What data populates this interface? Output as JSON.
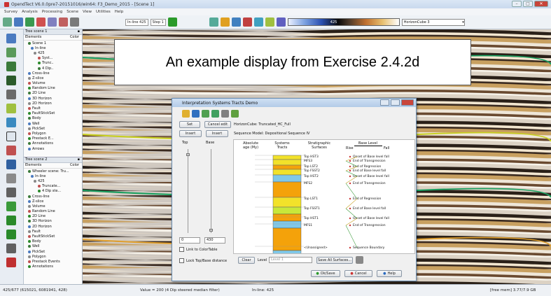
{
  "window": {
    "title": "OpendTect V6.0.0pre7-20151016/win64: F3_Demo_2015 - [Scene 1]"
  },
  "menu": [
    "Survey",
    "Analysis",
    "Processing",
    "Scene",
    "View",
    "Utilities",
    "Help"
  ],
  "toolbar": {
    "inline_label": "In-line 425",
    "step_label": "Step 1",
    "color_value": "425",
    "horizon_select": "HorizonCube 3"
  },
  "banner": {
    "text": "An example display from Exercise 2.4.2d"
  },
  "tree1": {
    "header": "Tree scene 1",
    "col_elements": "Elements",
    "col_color": "Color",
    "items": [
      "Scene 1",
      "In-line",
      "425",
      "Syst...",
      "Trunc..",
      "4 Dip..",
      "Cross-line",
      "Z-slice",
      "Volume",
      "Random Line",
      "2D Line",
      "3D Horizon",
      "2D Horizon",
      "Fault",
      "FaultStickSet",
      "Body",
      "Well",
      "PickSet",
      "Polygon",
      "Prestack E...",
      "Annotations",
      "Arrows"
    ]
  },
  "tree2": {
    "header": "Tree scene 2",
    "col_elements": "Elements",
    "col_color": "Color",
    "items": [
      "Wheeler scene: Tru...",
      "In-line",
      "425",
      "Truncate...",
      "4 Dip ste...",
      "Cross-line",
      "Z-slice",
      "Volume",
      "Random Line",
      "2D Line",
      "3D Horizon",
      "2D Horizon",
      "Fault",
      "FaultStickSet",
      "Body",
      "Well",
      "PickSet",
      "Polygon",
      "Prestack Events",
      "Annotations"
    ]
  },
  "dialog": {
    "title": "Interpretation Systems Tracts Demo",
    "set_btn": "Set",
    "cancel_edit_btn": "Cancel edit",
    "horizoncube": "HorizonCube: Truncated_HC_Full",
    "insert1": "Insert",
    "insert2": "Insert",
    "sequence_model": "Sequence Model: Depositional Sequence IV",
    "top_label": "Top",
    "base_label": "Base",
    "col_age": "Absolute age (My)",
    "col_tracts": "Systems Tracts",
    "col_surfaces": "Stratigraphic Surfaces",
    "col_base": "Base Level",
    "rise": "Rise",
    "fall": "Fall",
    "top_value": "0",
    "base_value": "430",
    "link_colortable": "Link to ColorTable",
    "lock_distance": "Lock Top/Base distance",
    "clear_btn": "Clear",
    "level_label": "Level",
    "level_value": "Level 1",
    "save_surfaces_btn": "Save All Surfaces...",
    "ok_btn": "Ok/Save",
    "cancel_btn": "Cancel",
    "help_btn": "Help",
    "surfaces": [
      "Top HST3",
      "MFS3",
      "Top LST2",
      "Top FSST2",
      "Top HST2",
      "MFS2",
      "Top LST1",
      "Top FSST1",
      "Top HST1",
      "MFS1",
      "<Unassigned>"
    ],
    "events": [
      "Onset of Base level fall",
      "End of Transgression",
      "End of Regression",
      "End of Base level fall",
      "Onset of Base level fall",
      "End of Transgression",
      "End of Regression",
      "End of Base level fall",
      "Onset of Base level fall",
      "End of Transgression",
      "Sequence Boundary"
    ]
  },
  "status": {
    "pos": "425/677  (615021, 6081941, 428)",
    "value": "Value = 200    (4 Dip steered median filter)",
    "inline": "In-line: 425",
    "mem": "[free mem] 3.77/7.9 GB"
  }
}
